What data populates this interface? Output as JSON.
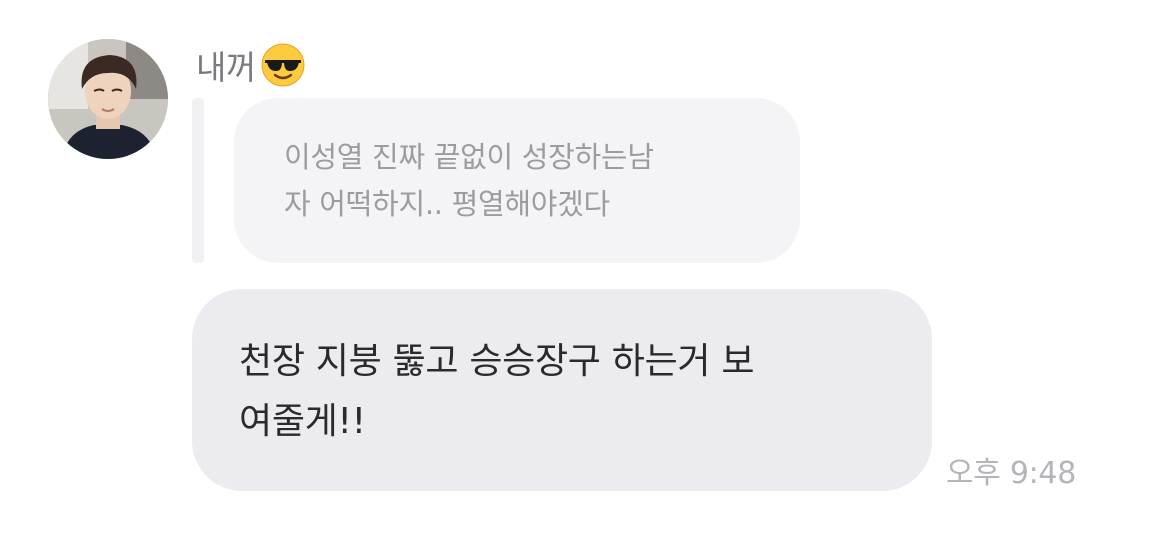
{
  "message": {
    "sender": {
      "name": "내꺼",
      "avatar": "profile-photo",
      "emoji": "smiling-face-with-sunglasses"
    },
    "quoted_reply": {
      "text": "이성열 진짜 끝없이 성장하는남\n자 어떡하지.. 평열해야겠다"
    },
    "body": {
      "text": "천장 지붕 뚫고 승승장구 하는거 보\n여줄게!!"
    },
    "timestamp": "오후 9:48"
  },
  "colors": {
    "main_bubble": "#ececf0",
    "quoted_bubble": "#f4f4f7",
    "sender_name": "#7a7a80",
    "timestamp": "#b4b4ba"
  }
}
